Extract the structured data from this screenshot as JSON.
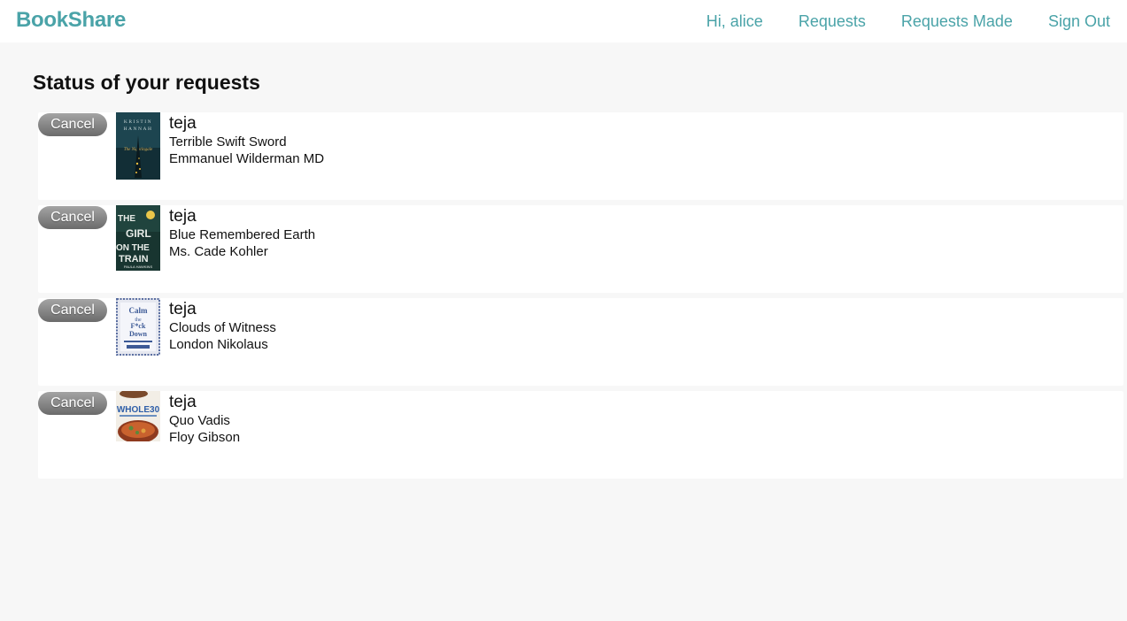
{
  "brand": "BookShare",
  "nav": {
    "greeting": "Hi, alice",
    "requests": "Requests",
    "requests_made": "Requests Made",
    "sign_out": "Sign Out"
  },
  "page_title": "Status of your requests",
  "requests": [
    {
      "cancel_label": "Cancel",
      "owner": "teja",
      "title": "Terrible Swift Sword",
      "author": "Emmanuel Wilderman MD",
      "cover_text": "KRISTIN HANNAH"
    },
    {
      "cancel_label": "Cancel",
      "owner": "teja",
      "title": "Blue Remembered Earth",
      "author": "Ms. Cade Kohler",
      "cover_text": "THE GIRL ON THE TRAIN"
    },
    {
      "cancel_label": "Cancel",
      "owner": "teja",
      "title": "Clouds of Witness",
      "author": "London Nikolaus",
      "cover_text": "Calm the F*ck Down"
    },
    {
      "cancel_label": "Cancel",
      "owner": "teja",
      "title": "Quo Vadis",
      "author": "Floy Gibson",
      "cover_text": "WHOLE30"
    }
  ],
  "colors": {
    "accent": "#4aa3a8",
    "background": "#f7f7f7",
    "card": "#ffffff",
    "button": "#888888"
  }
}
